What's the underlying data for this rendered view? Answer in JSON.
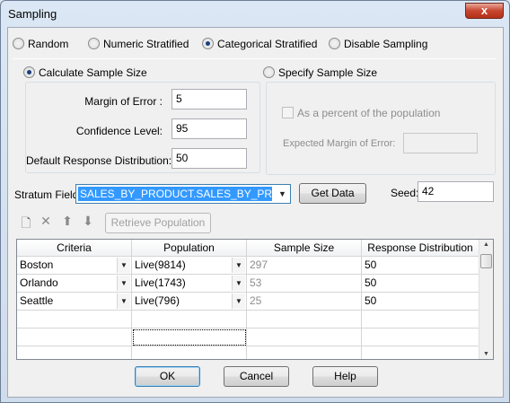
{
  "window": {
    "title": "Sampling",
    "close_glyph": "x"
  },
  "sampling_mode": {
    "options": [
      "Random",
      "Numeric Stratified",
      "Categorical Stratified",
      "Disable Sampling"
    ],
    "selected": "Categorical Stratified"
  },
  "calculate": {
    "radio_label": "Calculate Sample Size",
    "margin_label": "Margin of Error :",
    "margin_value": "5",
    "confidence_label": "Confidence Level:",
    "confidence_value": "95",
    "response_label": "Default Response Distribution:",
    "response_value": "50"
  },
  "specify": {
    "radio_label": "Specify Sample Size",
    "percent_label": "As a percent of the population",
    "expected_margin_label": "Expected Margin of Error:",
    "expected_margin_value": ""
  },
  "stratum": {
    "label": "Stratum Field:",
    "value": "SALES_BY_PRODUCT.SALES_BY_PRODU",
    "get_data_label": "Get Data",
    "seed_label": "Seed:",
    "seed_value": "42"
  },
  "toolbar": {
    "retrieve_label": "Retrieve Population"
  },
  "grid": {
    "columns": [
      "Criteria",
      "Population",
      "Sample Size",
      "Response Distribution"
    ],
    "rows": [
      {
        "criteria": "Boston",
        "population": "Live(9814)",
        "sample_size": "297",
        "response": "50"
      },
      {
        "criteria": "Orlando",
        "population": "Live(1743)",
        "sample_size": "53",
        "response": "50"
      },
      {
        "criteria": "Seattle",
        "population": "Live(796)",
        "sample_size": "25",
        "response": "50"
      }
    ]
  },
  "footer": {
    "ok_label": "OK",
    "cancel_label": "Cancel",
    "help_label": "Help"
  }
}
